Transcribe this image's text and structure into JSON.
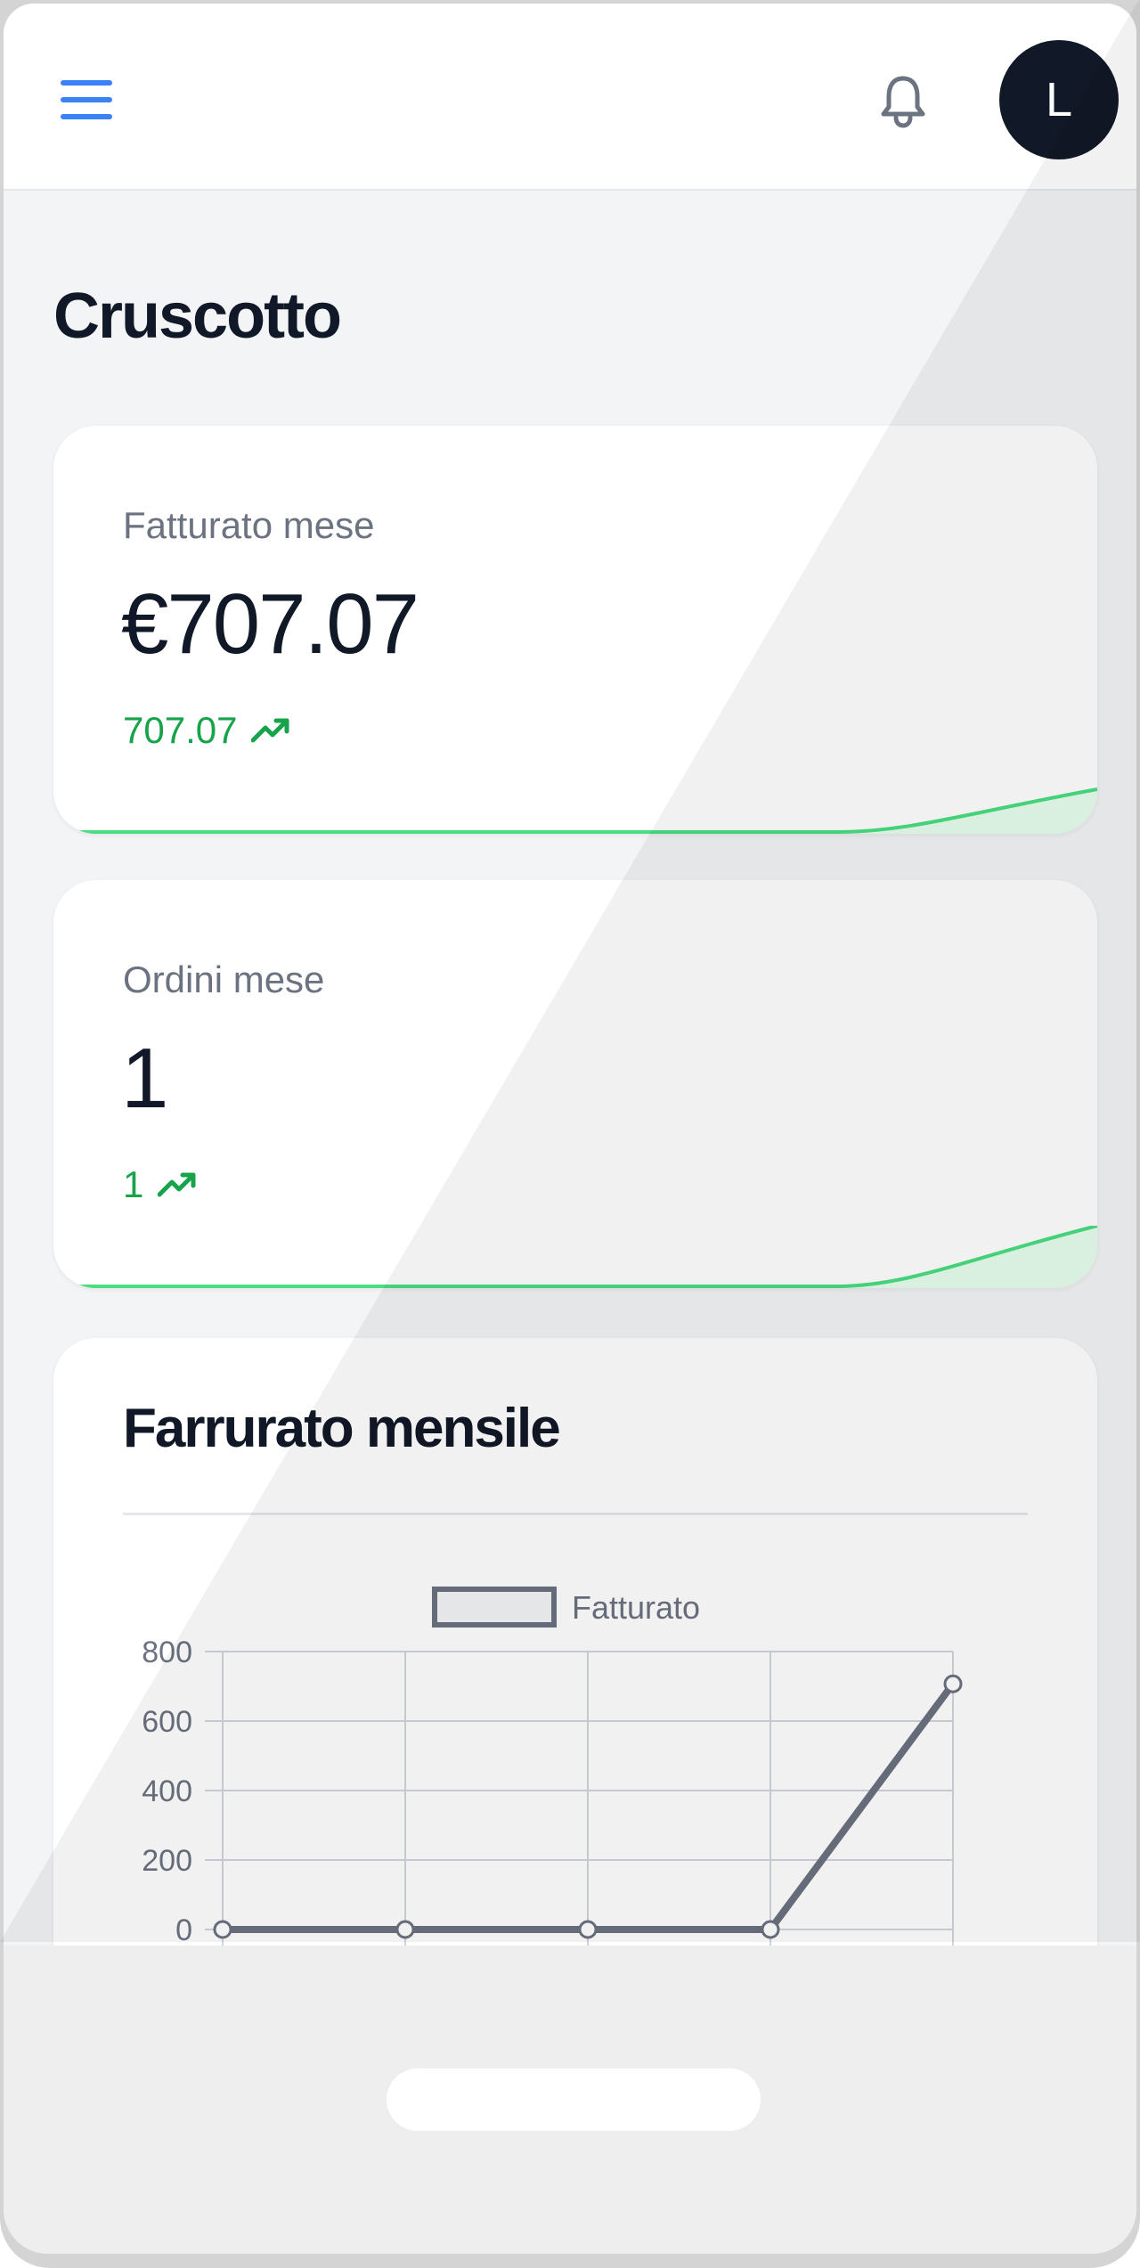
{
  "header": {
    "avatar_initial": "L"
  },
  "page": {
    "title": "Cruscotto"
  },
  "cards": {
    "revenue": {
      "label": "Fatturato mese",
      "value": "€707.07",
      "trend": "707.07"
    },
    "orders": {
      "label": "Ordini mese",
      "value": "1",
      "trend": "1"
    }
  },
  "colors": {
    "accent": "#3b82f6",
    "positive": "#16a34a",
    "sparkline": "#4ade80",
    "series": "#6b7280",
    "avatar_bg": "#111827"
  },
  "icons": {
    "menu": "hamburger-menu-icon",
    "notifications": "bell-icon",
    "trend": "trending-up-icon"
  },
  "chart": {
    "title": "Farrurato mensile"
  },
  "chart_data": {
    "type": "line",
    "title": "Farrurato mensile",
    "x": [
      "",
      "",
      "",
      "",
      ""
    ],
    "series": [
      {
        "name": "Fatturato",
        "values": [
          0,
          0,
          0,
          0,
          707.07
        ]
      }
    ],
    "yticks": [
      "0",
      "200",
      "400",
      "600",
      "800"
    ],
    "ylim": [
      0,
      800
    ],
    "grid": true,
    "legend": "top-center"
  }
}
